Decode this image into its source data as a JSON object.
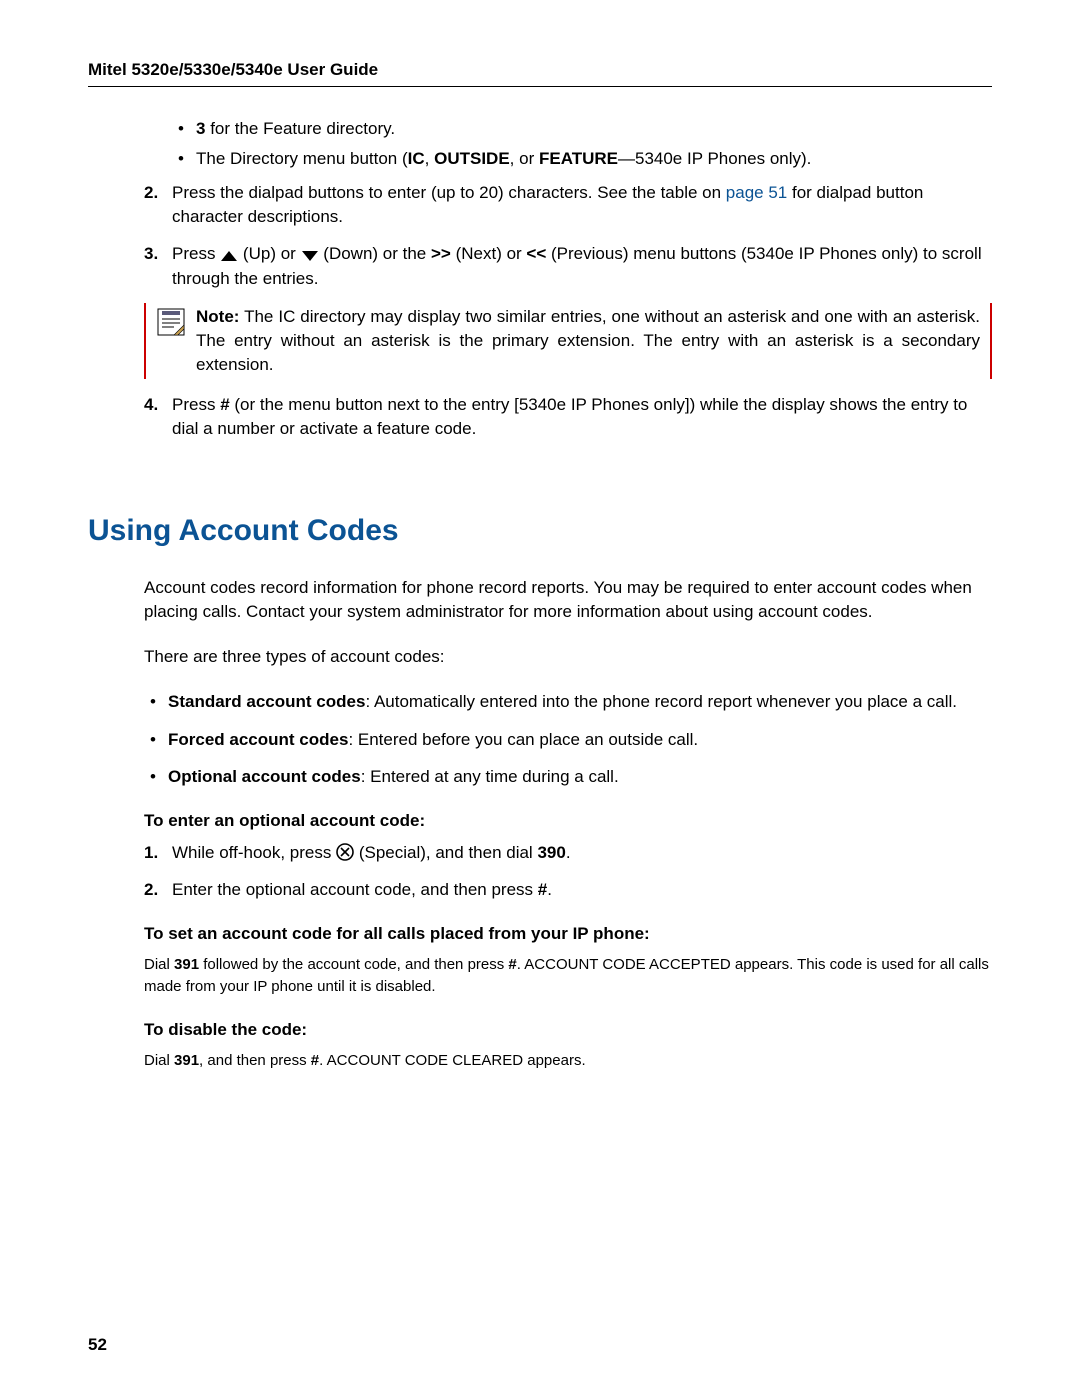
{
  "header": {
    "title": "Mitel 5320e/5330e/5340e User Guide"
  },
  "top_bullets": {
    "b1_bold": "3",
    "b1_tail": " for the Feature directory.",
    "b2_pre": "The Directory menu button (",
    "b2_bold1": "IC",
    "b2_sep1": ", ",
    "b2_bold2": "OUTSIDE",
    "b2_sep2": ", or ",
    "b2_bold3": "FEATURE",
    "b2_tail": "—5340e IP Phones only)."
  },
  "steps": {
    "s2_num": "2.",
    "s2_text_pre": "Press the dialpad buttons to enter (up to 20) characters. See the table on ",
    "s2_link": "page 51",
    "s2_text_post": " for dialpad button character descriptions.",
    "s3_num": "3.",
    "s3_p1": "Press ",
    "s3_up_lbl": " (Up) or ",
    "s3_down_lbl": " (Down) or the ",
    "s3_next": ">>",
    "s3_next_lbl": " (Next) or ",
    "s3_prev": "<<",
    "s3_prev_lbl": " (Previous) menu buttons (5340e IP Phones only) to scroll through the entries.",
    "s4_num": "4.",
    "s4_p1": "Press ",
    "s4_hash": "#",
    "s4_p2": " (or the menu button next to the entry [5340e IP Phones only]) while the display shows the entry to dial a number or activate a feature code."
  },
  "note": {
    "label": "Note:",
    "text": " The IC directory may display two similar entries, one without an asterisk and one with an asterisk. The entry without an asterisk is the primary extension. The entry with an asterisk is a secondary extension."
  },
  "section": {
    "heading": "Using Account Codes",
    "intro": "Account codes record information for phone record reports. You may be required to enter account codes when placing calls. Contact your system administrator for more information about using account codes.",
    "types_lead": "There are three types of account codes:",
    "type1_bold": "Standard account codes",
    "type1_text": ": Automatically entered into the phone record report whenever you place a call.",
    "type2_bold": "Forced account codes",
    "type2_text": ": Entered before you can place an outside call.",
    "type3_bold": "Optional account codes",
    "type3_text": ": Entered at any time during a call.",
    "opt_heading": "To enter an optional account code:",
    "opt_s1_num": "1.",
    "opt_s1_p1": "While off-hook, press ",
    "opt_s1_p2": " (Special), and then dial ",
    "opt_s1_code": "390",
    "opt_s1_p3": ".",
    "opt_s2_num": "2.",
    "opt_s2_p1": "Enter the optional account code, and then press ",
    "opt_s2_hash": "#",
    "opt_s2_p2": ".",
    "set_heading": "To set an account code for all calls placed from your IP phone:",
    "set_p1": "Dial ",
    "set_code": "391",
    "set_p2": " followed by the account code, and then press ",
    "set_hash": "#",
    "set_p3": ". ACCOUNT CODE ACCEPTED appears. This code is used for all calls made from your IP phone until it is disabled.",
    "dis_heading": "To disable the code:",
    "dis_p1": "Dial ",
    "dis_code": "391",
    "dis_p2": ", and then press ",
    "dis_hash": "#",
    "dis_p3": ". ACCOUNT CODE CLEARED appears."
  },
  "page_number": "52"
}
